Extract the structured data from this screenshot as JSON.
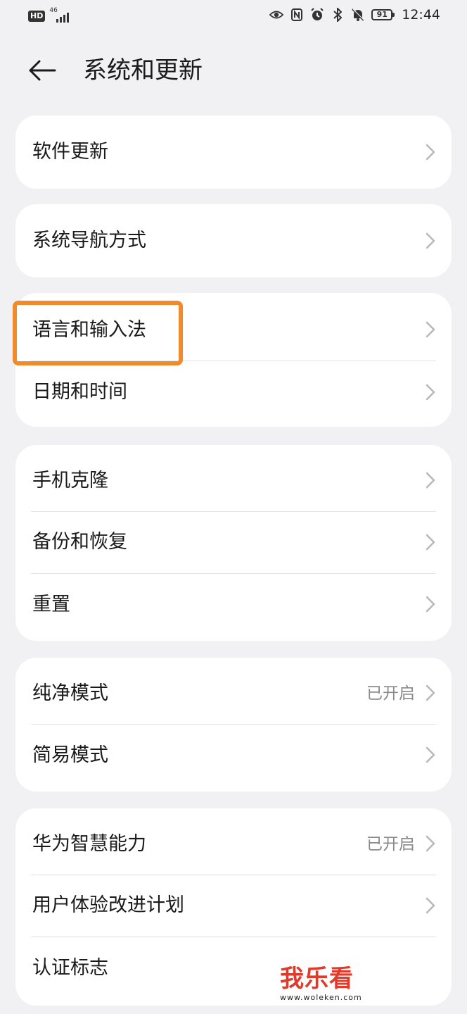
{
  "status_bar": {
    "hd_label": "HD",
    "network_label": "46",
    "battery_level": "91",
    "time": "12:44",
    "icons": [
      "eye-icon",
      "nfc-icon",
      "alarm-icon",
      "bluetooth-icon",
      "mute-icon"
    ]
  },
  "header": {
    "title": "系统和更新"
  },
  "groups": [
    {
      "items": [
        {
          "label": "软件更新"
        }
      ]
    },
    {
      "items": [
        {
          "label": "系统导航方式"
        }
      ]
    },
    {
      "items": [
        {
          "label": "语言和输入法"
        },
        {
          "label": "日期和时间"
        }
      ]
    },
    {
      "items": [
        {
          "label": "手机克隆"
        },
        {
          "label": "备份和恢复"
        },
        {
          "label": "重置"
        }
      ]
    },
    {
      "items": [
        {
          "label": "纯净模式",
          "value": "已开启"
        },
        {
          "label": "简易模式"
        }
      ]
    },
    {
      "items": [
        {
          "label": "华为智慧能力",
          "value": "已开启"
        },
        {
          "label": "用户体验改进计划"
        },
        {
          "label": "认证标志"
        }
      ]
    }
  ],
  "highlight_color": "#f08a2a",
  "watermark": {
    "text": "我乐看",
    "url": "www.woleken.com"
  }
}
